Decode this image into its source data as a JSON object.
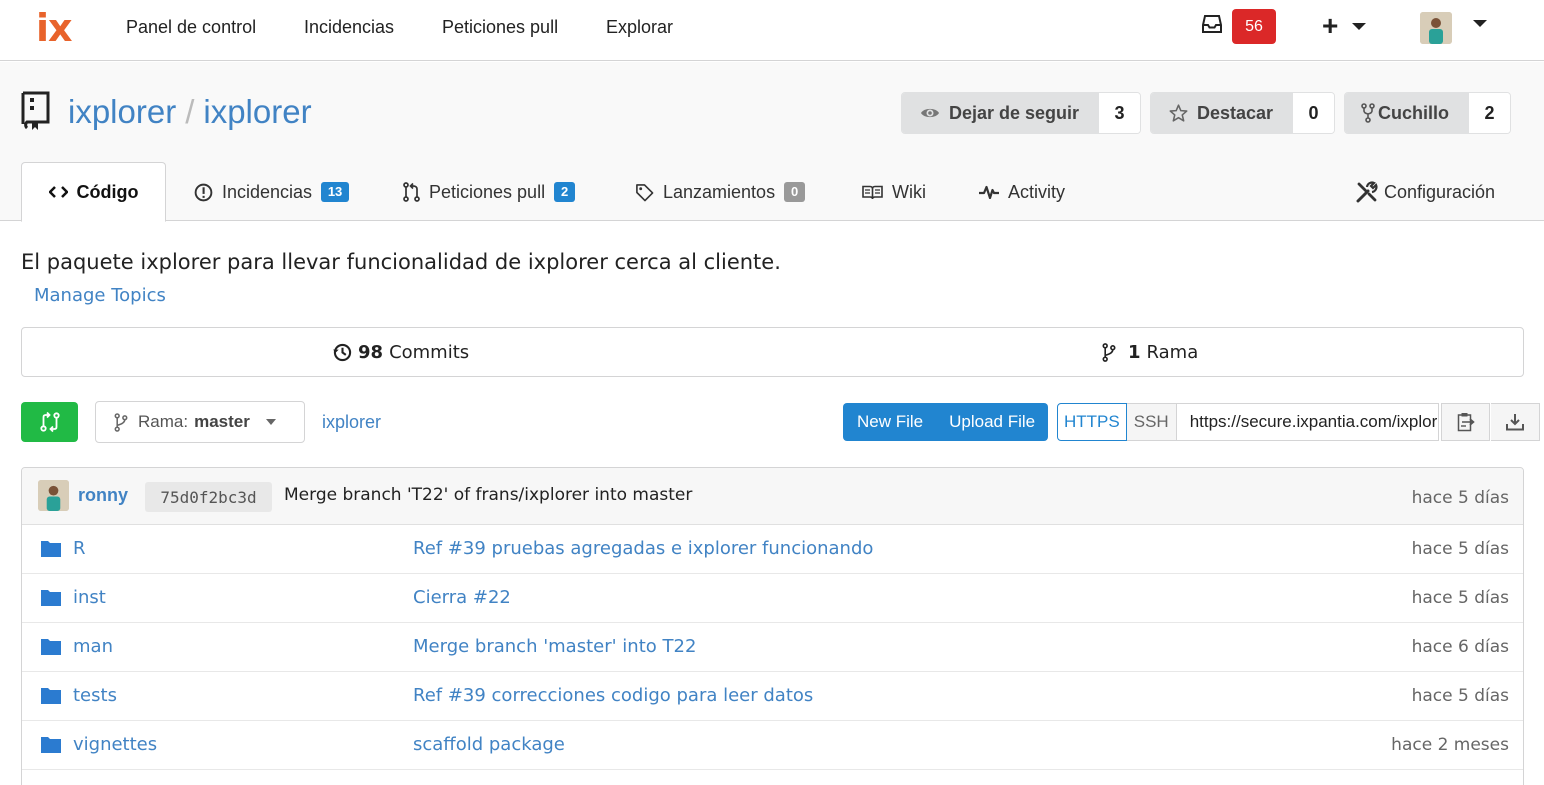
{
  "nav": {
    "logo": "ix",
    "links": [
      "Panel de control",
      "Incidencias",
      "Peticiones pull",
      "Explorar"
    ],
    "notifications_count": "56",
    "plus": "+"
  },
  "repo": {
    "owner": "ixplorer",
    "separator": "/",
    "name": "ixplorer",
    "actions": {
      "watch": {
        "label": "Dejar de seguir",
        "count": "3"
      },
      "star": {
        "label": "Destacar",
        "count": "0"
      },
      "fork": {
        "label": "Cuchillo",
        "count": "2"
      }
    }
  },
  "tabs": {
    "code": "Código",
    "issues": {
      "label": "Incidencias",
      "count": "13"
    },
    "pulls": {
      "label": "Peticiones pull",
      "count": "2"
    },
    "releases": {
      "label": "Lanzamientos",
      "count": "0"
    },
    "wiki": "Wiki",
    "activity": "Activity",
    "settings": "Configuración"
  },
  "description": "El paquete ixplorer para llevar funcionalidad de ixplorer cerca al cliente.",
  "manage_topics": "Manage Topics",
  "stats": {
    "commits_count": "98",
    "commits_label": "Commits",
    "branches_count": "1",
    "branches_label": "Rama"
  },
  "toolbar": {
    "branch_prefix": "Rama:",
    "branch_name": "master",
    "breadcrumb": "ixplorer",
    "new_file": "New File",
    "upload_file": "Upload File",
    "https": "HTTPS",
    "ssh": "SSH",
    "clone_url": "https://secure.ixpantia.com/ixplorer/ixplorer.git"
  },
  "latest_commit": {
    "user": "ronny",
    "sha": "75d0f2bc3d",
    "message": "Merge branch 'T22' of frans/ixplorer into master",
    "time": "hace 5 días"
  },
  "files": [
    {
      "name": "R",
      "message": "Ref #39 pruebas agregadas e ixplorer funcionando",
      "time": "hace 5 días"
    },
    {
      "name": "inst",
      "message": "Cierra #22",
      "time": "hace 5 días"
    },
    {
      "name": "man",
      "message": "Merge branch 'master' into T22",
      "time": "hace 6 días"
    },
    {
      "name": "tests",
      "message": "Ref #39 correcciones codigo para leer datos",
      "time": "hace 5 días"
    },
    {
      "name": "vignettes",
      "message": "scaffold package",
      "time": "hace 2 meses"
    }
  ],
  "colors": {
    "brand": "#e8632b",
    "link": "#4183c4",
    "primary": "#2185d0",
    "success": "#21ba45",
    "danger": "#db2828"
  }
}
